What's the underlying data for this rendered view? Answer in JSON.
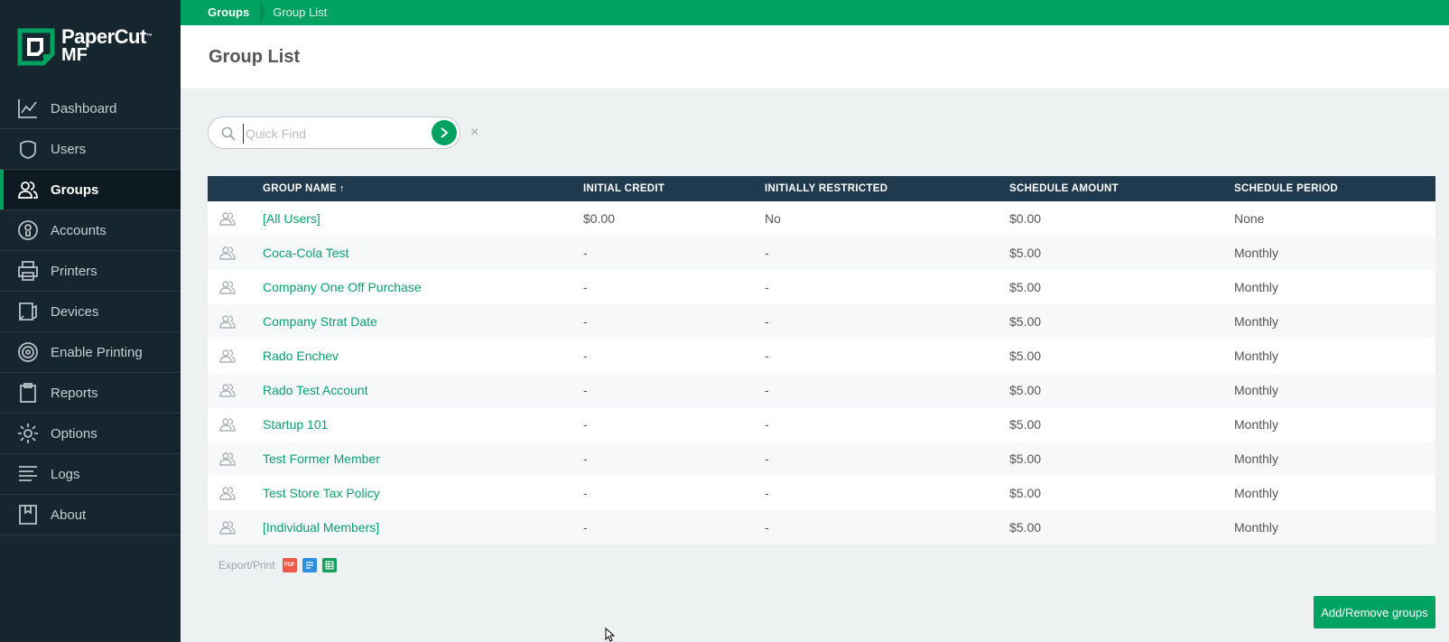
{
  "brand": {
    "name": "PaperCut",
    "product": "MF",
    "trademark": "™",
    "accent": "#00a262",
    "sidebar_bg": "#16262f"
  },
  "breadcrumb": {
    "root": "Groups",
    "current": "Group List"
  },
  "page_title": "Group List",
  "search": {
    "placeholder": "Quick Find",
    "value": "",
    "go_icon": "chevron-right-icon",
    "clear_label": "×"
  },
  "sidebar": {
    "items": [
      {
        "label": "Dashboard",
        "icon": "chart-line-icon",
        "active": false
      },
      {
        "label": "Users",
        "icon": "user-shield-icon",
        "active": false
      },
      {
        "label": "Groups",
        "icon": "group-users-icon",
        "active": true
      },
      {
        "label": "Accounts",
        "icon": "account-circle-icon",
        "active": false
      },
      {
        "label": "Printers",
        "icon": "printer-icon",
        "active": false
      },
      {
        "label": "Devices",
        "icon": "device-icon",
        "active": false
      },
      {
        "label": "Enable Printing",
        "icon": "radar-icon",
        "active": false
      },
      {
        "label": "Reports",
        "icon": "clipboard-icon",
        "active": false
      },
      {
        "label": "Options",
        "icon": "gear-icon",
        "active": false
      },
      {
        "label": "Logs",
        "icon": "list-lines-icon",
        "active": false
      },
      {
        "label": "About",
        "icon": "book-icon",
        "active": false
      }
    ]
  },
  "table": {
    "columns": [
      "GROUP NAME",
      "INITIAL CREDIT",
      "INITIALLY RESTRICTED",
      "SCHEDULE AMOUNT",
      "SCHEDULE PERIOD"
    ],
    "sort_indicator": "↑",
    "rows": [
      {
        "name": "[All Users]",
        "initial_credit": "$0.00",
        "restricted": "No",
        "amount": "$0.00",
        "period": "None"
      },
      {
        "name": "Coca-Cola Test",
        "initial_credit": "-",
        "restricted": "-",
        "amount": "$5.00",
        "period": "Monthly"
      },
      {
        "name": "Company One Off Purchase",
        "initial_credit": "-",
        "restricted": "-",
        "amount": "$5.00",
        "period": "Monthly"
      },
      {
        "name": "Company Strat Date",
        "initial_credit": "-",
        "restricted": "-",
        "amount": "$5.00",
        "period": "Monthly"
      },
      {
        "name": "Rado Enchev",
        "initial_credit": "-",
        "restricted": "-",
        "amount": "$5.00",
        "period": "Monthly"
      },
      {
        "name": "Rado Test Account",
        "initial_credit": "-",
        "restricted": "-",
        "amount": "$5.00",
        "period": "Monthly"
      },
      {
        "name": "Startup 101",
        "initial_credit": "-",
        "restricted": "-",
        "amount": "$5.00",
        "period": "Monthly"
      },
      {
        "name": "Test Former Member",
        "initial_credit": "-",
        "restricted": "-",
        "amount": "$5.00",
        "period": "Monthly"
      },
      {
        "name": "Test Store Tax Policy",
        "initial_credit": "-",
        "restricted": "-",
        "amount": "$5.00",
        "period": "Monthly"
      },
      {
        "name": "[Individual Members]",
        "initial_credit": "-",
        "restricted": "-",
        "amount": "$5.00",
        "period": "Monthly"
      }
    ]
  },
  "export": {
    "label": "Export/Print",
    "pdf_text": "PDF",
    "buttons": [
      "pdf-icon",
      "list-icon",
      "csv-icon"
    ]
  },
  "actions": {
    "add_remove": "Add/Remove groups"
  }
}
